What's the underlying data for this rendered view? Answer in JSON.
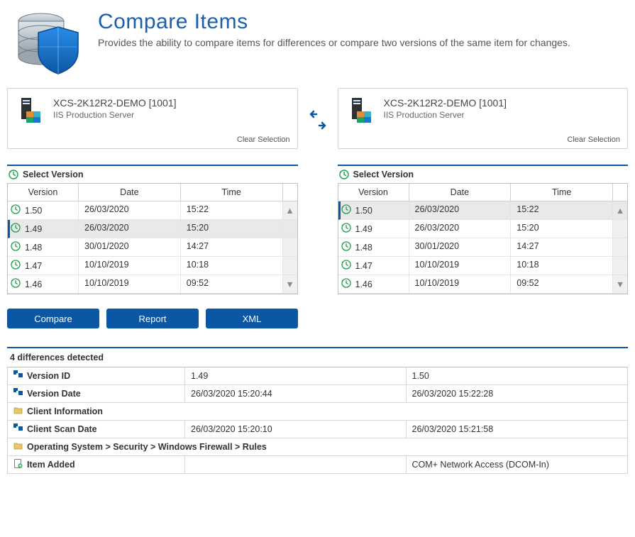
{
  "header": {
    "title": "Compare Items",
    "subtitle": "Provides the ability to compare items for differences or compare two versions of the same item for changes."
  },
  "leftItem": {
    "title": "XCS-2K12R2-DEMO [1001]",
    "subtitle": "IIS Production Server",
    "clear": "Clear Selection"
  },
  "rightItem": {
    "title": "XCS-2K12R2-DEMO [1001]",
    "subtitle": "IIS Production Server",
    "clear": "Clear Selection"
  },
  "versionSection": {
    "label": "Select Version",
    "columns": {
      "version": "Version",
      "date": "Date",
      "time": "Time"
    }
  },
  "leftVersions": {
    "selectedIndex": 1,
    "rows": [
      {
        "version": "1.50",
        "date": "26/03/2020",
        "time": "15:22"
      },
      {
        "version": "1.49",
        "date": "26/03/2020",
        "time": "15:20"
      },
      {
        "version": "1.48",
        "date": "30/01/2020",
        "time": "14:27"
      },
      {
        "version": "1.47",
        "date": "10/10/2019",
        "time": "10:18"
      },
      {
        "version": "1.46",
        "date": "10/10/2019",
        "time": "09:52"
      }
    ]
  },
  "rightVersions": {
    "selectedIndex": 0,
    "rows": [
      {
        "version": "1.50",
        "date": "26/03/2020",
        "time": "15:22"
      },
      {
        "version": "1.49",
        "date": "26/03/2020",
        "time": "15:20"
      },
      {
        "version": "1.48",
        "date": "30/01/2020",
        "time": "14:27"
      },
      {
        "version": "1.47",
        "date": "10/10/2019",
        "time": "10:18"
      },
      {
        "version": "1.46",
        "date": "10/10/2019",
        "time": "09:52"
      }
    ]
  },
  "buttons": {
    "compare": "Compare",
    "report": "Report",
    "xml": "XML"
  },
  "diff": {
    "summary": "4 differences detected",
    "rows": [
      {
        "type": "compare",
        "label": "Version ID",
        "left": "1.49",
        "right": "1.50"
      },
      {
        "type": "compare",
        "label": "Version Date",
        "left": "26/03/2020 15:20:44",
        "right": "26/03/2020 15:22:28"
      },
      {
        "type": "group",
        "label": "Client Information"
      },
      {
        "type": "compare",
        "label": "Client Scan Date",
        "left": "26/03/2020 15:20:10",
        "right": "26/03/2020 15:21:58"
      },
      {
        "type": "group",
        "label": "Operating System > Security > Windows Firewall > Rules"
      },
      {
        "type": "added",
        "label": "Item Added",
        "left": "",
        "right": "COM+ Network Access (DCOM-In)"
      }
    ]
  }
}
